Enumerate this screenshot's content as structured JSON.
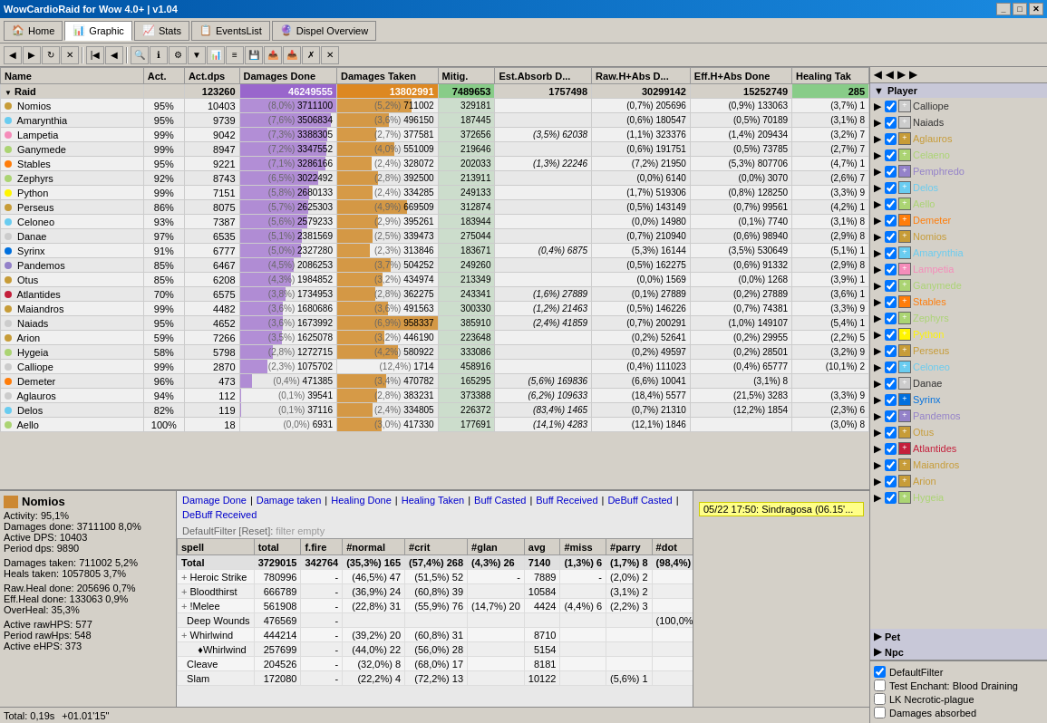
{
  "app": {
    "title": "WowCardioRaid for Wow 4.0+ | v1.04",
    "tabs": [
      "Home",
      "Graphic",
      "Stats",
      "EventsList",
      "Dispel Overview"
    ]
  },
  "toolbar_icons": [
    "arrow-left",
    "arrow-right",
    "refresh",
    "stop",
    "home",
    "search",
    "info",
    "settings",
    "filter",
    "down",
    "up",
    "save",
    "open",
    "close",
    "expand",
    "collapse",
    "chart",
    "list"
  ],
  "table": {
    "headers": [
      "Name",
      "Act.",
      "Act.dps",
      "Damages Done",
      "Damages Taken",
      "Mitig.",
      "Est.Absorb D...",
      "Raw.H+Abs D...",
      "Eff.H+Abs Done",
      "Healing Tak"
    ],
    "raid_row": {
      "name": "Raid",
      "total": "123260",
      "dmg_done": "46249555",
      "dmg_taken": "13802991",
      "mitig": "7489653",
      "absorb": "1757498",
      "raw_h": "30299142",
      "eff_h": "15252749",
      "heal_taken": "285"
    },
    "rows": [
      {
        "name": "Nomios",
        "act": "95%",
        "dps": "10403",
        "dmg_done": "3711100",
        "pct_dd": "(8,0%)",
        "dmg_taken": "711002",
        "pct_dt": "(5,2%)",
        "mitig": "329181",
        "absorb": "",
        "raw_h": "(0,7%) 205696",
        "eff_h": "(0,9%) 133063",
        "heal_taken": "(3,7%) 1",
        "class": "warrior",
        "color": "#c08020"
      },
      {
        "name": "Amarynthia",
        "act": "95%",
        "dps": "9739",
        "dmg_done": "3506834",
        "pct_dd": "(7,6%)",
        "dmg_taken": "496150",
        "pct_dt": "(3,6%)",
        "mitig": "187445",
        "absorb": "",
        "raw_h": "(0,6%) 180547",
        "eff_h": "(0,5%) 70189",
        "heal_taken": "(3,1%) 8",
        "class": "mage",
        "color": "#69ccf0"
      },
      {
        "name": "Lampetia",
        "act": "99%",
        "dps": "9042",
        "dmg_done": "3388305",
        "pct_dd": "(7,3%)",
        "dmg_taken": "377581",
        "pct_dt": "(2,7%)",
        "mitig": "372656",
        "absorb": "(3,5%) 62038",
        "raw_h": "(1,1%) 323376",
        "eff_h": "(1,4%) 209434",
        "heal_taken": "(3,2%) 7",
        "class": "paladin",
        "color": "#f58cba"
      },
      {
        "name": "Ganymede",
        "act": "99%",
        "dps": "8947",
        "dmg_done": "3347552",
        "pct_dd": "(7,2%)",
        "dmg_taken": "551009",
        "pct_dt": "(4,0%)",
        "mitig": "219646",
        "absorb": "",
        "raw_h": "(0,6%) 191751",
        "eff_h": "(0,5%) 73785",
        "heal_taken": "(2,7%) 7",
        "class": "hunter",
        "color": "#abd473"
      },
      {
        "name": "Stables",
        "act": "95%",
        "dps": "9221",
        "dmg_done": "3286166",
        "pct_dd": "(7,1%)",
        "dmg_taken": "328072",
        "pct_dt": "(2,4%)",
        "mitig": "202033",
        "absorb": "(1,3%) 22246",
        "raw_h": "(7,2%) 21950",
        "eff_h": "(5,3%) 807706",
        "heal_taken": "(4,7%) 1",
        "class": "druid",
        "color": "#ff7d0a"
      },
      {
        "name": "Zephyrs",
        "act": "92%",
        "dps": "8743",
        "dmg_done": "3022492",
        "pct_dd": "(6,5%)",
        "dmg_taken": "392500",
        "pct_dt": "(2,8%)",
        "mitig": "213911",
        "absorb": "",
        "raw_h": "(0,0%) 6140",
        "eff_h": "(0,0%) 3070",
        "heal_taken": "(2,6%) 7",
        "class": "hunter",
        "color": "#abd473"
      },
      {
        "name": "Python",
        "act": "99%",
        "dps": "7151",
        "dmg_done": "2680133",
        "pct_dd": "(5,8%)",
        "dmg_taken": "334285",
        "pct_dt": "(2,4%)",
        "mitig": "249133",
        "absorb": "",
        "raw_h": "(1,7%) 519306",
        "eff_h": "(0,8%) 128250",
        "heal_taken": "(3,3%) 9",
        "class": "rogue",
        "color": "#fff569"
      },
      {
        "name": "Perseus",
        "act": "86%",
        "dps": "8075",
        "dmg_done": "2625303",
        "pct_dd": "(5,7%)",
        "dmg_taken": "669509",
        "pct_dt": "(4,9%)",
        "mitig": "312874",
        "absorb": "",
        "raw_h": "(0,5%) 143149",
        "eff_h": "(0,7%) 99561",
        "heal_taken": "(4,2%) 1",
        "class": "warrior",
        "color": "#c79c38"
      },
      {
        "name": "Celoneo",
        "act": "93%",
        "dps": "7387",
        "dmg_done": "2579233",
        "pct_dd": "(5,6%)",
        "dmg_taken": "395261",
        "pct_dt": "(2,9%)",
        "mitig": "183944",
        "absorb": "",
        "raw_h": "(0,0%) 14980",
        "eff_h": "(0,1%) 7740",
        "heal_taken": "(3,1%) 8",
        "class": "mage",
        "color": "#69ccf0"
      },
      {
        "name": "Danae",
        "act": "97%",
        "dps": "6535",
        "dmg_done": "2381569",
        "pct_dd": "(5,1%)",
        "dmg_taken": "339473",
        "pct_dt": "(2,5%)",
        "mitig": "275044",
        "absorb": "",
        "raw_h": "(0,7%) 210940",
        "eff_h": "(0,6%) 98940",
        "heal_taken": "(2,9%) 8",
        "class": "priest",
        "color": "#ddd"
      },
      {
        "name": "Syrinx",
        "act": "91%",
        "dps": "6777",
        "dmg_done": "2327280",
        "pct_dd": "(5,0%)",
        "dmg_taken": "313846",
        "pct_dt": "(2,3%)",
        "mitig": "183671",
        "absorb": "(0,4%) 6875",
        "raw_h": "(5,3%) 16144",
        "eff_h": "(3,5%) 530649",
        "heal_taken": "(5,1%) 1",
        "class": "shaman",
        "color": "#0070de"
      },
      {
        "name": "Pandemos",
        "act": "85%",
        "dps": "6467",
        "dmg_done": "2086253",
        "pct_dd": "(4,5%)",
        "dmg_taken": "504252",
        "pct_dt": "(3,7%)",
        "mitig": "249260",
        "absorb": "",
        "raw_h": "(0,5%) 162275",
        "eff_h": "(0,6%) 91332",
        "heal_taken": "(2,9%) 8",
        "class": "warlock",
        "color": "#9482c9"
      },
      {
        "name": "Otus",
        "act": "85%",
        "dps": "6208",
        "dmg_done": "1984852",
        "pct_dd": "(4,3%)",
        "dmg_taken": "434974",
        "pct_dt": "(3,2%)",
        "mitig": "213349",
        "absorb": "",
        "raw_h": "(0,0%) 1569",
        "eff_h": "(0,0%) 1268",
        "heal_taken": "(3,9%) 1",
        "class": "warrior",
        "color": "#c79c38"
      },
      {
        "name": "Atlantides",
        "act": "70%",
        "dps": "6575",
        "dmg_done": "1734953",
        "pct_dd": "(3,8%)",
        "dmg_taken": "362275",
        "pct_dt": "(2,8%)",
        "mitig": "243341",
        "absorb": "(1,6%) 27889",
        "raw_h": "(0,1%) 27889",
        "eff_h": "(0,2%) 27889",
        "heal_taken": "(3,6%) 1",
        "class": "dk",
        "color": "#c41f3b"
      },
      {
        "name": "Maiandros",
        "act": "99%",
        "dps": "4482",
        "dmg_done": "1680686",
        "pct_dd": "(3,6%)",
        "dmg_taken": "491563",
        "pct_dt": "(3,6%)",
        "mitig": "300330",
        "absorb": "(1,2%) 21463",
        "raw_h": "(0,5%) 146226",
        "eff_h": "(0,7%) 74381",
        "heal_taken": "(3,3%) 9",
        "class": "warrior",
        "color": "#c79c38"
      },
      {
        "name": "Naiads",
        "act": "95%",
        "dps": "4652",
        "dmg_done": "1673992",
        "pct_dd": "(3,6%)",
        "dmg_taken": "958337",
        "pct_dt": "(6,9%)",
        "mitig": "385910",
        "absorb": "(2,4%) 41859",
        "raw_h": "(0,7%) 200291",
        "eff_h": "(1,0%) 149107",
        "heal_taken": "(5,4%) 1",
        "class": "priest",
        "color": "#ddd"
      },
      {
        "name": "Arion",
        "act": "59%",
        "dps": "7266",
        "dmg_done": "1625078",
        "pct_dd": "(3,5%)",
        "dmg_taken": "446190",
        "pct_dt": "(3,2%)",
        "mitig": "223648",
        "absorb": "",
        "raw_h": "(0,2%) 52641",
        "eff_h": "(0,2%) 29955",
        "heal_taken": "(2,2%) 5",
        "class": "warrior",
        "color": "#c79c38"
      },
      {
        "name": "Hygeia",
        "act": "58%",
        "dps": "5798",
        "dmg_done": "1272715",
        "pct_dd": "(2,8%)",
        "dmg_taken": "580922",
        "pct_dt": "(4,2%)",
        "mitig": "333086",
        "absorb": "",
        "raw_h": "(0,2%) 49597",
        "eff_h": "(0,2%) 28501",
        "heal_taken": "(3,2%) 9",
        "class": "hunter",
        "color": "#abd473"
      },
      {
        "name": "Calliope",
        "act": "99%",
        "dps": "2870",
        "dmg_done": "1075702",
        "pct_dd": "(2,3%)",
        "dmg_taken": "1714",
        "pct_dt": "(12,4%)",
        "mitig": "458916",
        "absorb": "",
        "raw_h": "(0,4%) 111023",
        "eff_h": "(0,4%) 65777",
        "heal_taken": "(10,1%) 2",
        "class": "priest",
        "color": "#ddd"
      },
      {
        "name": "Demeter",
        "act": "96%",
        "dps": "473",
        "dmg_done": "471385",
        "pct_dd": "(0,4%)",
        "dmg_taken": "470782",
        "pct_dt": "(3,4%)",
        "mitig": "165295",
        "absorb": "(5,6%) 169836",
        "raw_h": "(6,6%) 10041",
        "eff_h": "(3,1%) 8",
        "heal_taken": "",
        "class": "druid",
        "color": "#ff7d0a"
      },
      {
        "name": "Aglauros",
        "act": "94%",
        "dps": "112",
        "dmg_done": "39541",
        "pct_dd": "(0,1%)",
        "dmg_taken": "383231",
        "pct_dt": "(2,8%)",
        "mitig": "373388",
        "absorb": "(6,2%) 109633",
        "raw_h": "(18,4%) 5577",
        "eff_h": "(21,5%) 3283",
        "heal_taken": "(3,3%) 9",
        "class": "priest",
        "color": "#ddd"
      },
      {
        "name": "Delos",
        "act": "82%",
        "dps": "119",
        "dmg_done": "37116",
        "pct_dd": "(0,1%)",
        "dmg_taken": "334805",
        "pct_dt": "(2,4%)",
        "mitig": "226372",
        "absorb": "(83,4%) 1465",
        "raw_h": "(0,7%) 21310",
        "eff_h": "(12,2%) 1854",
        "heal_taken": "(2,3%) 6",
        "class": "mage",
        "color": "#69ccf0"
      },
      {
        "name": "Aello",
        "act": "100%",
        "dps": "18",
        "dmg_done": "6931",
        "pct_dd": "(0,0%)",
        "dmg_taken": "417330",
        "pct_dt": "(3,0%)",
        "mitig": "177691",
        "absorb": "(14,1%) 4283",
        "raw_h": "(12,1%) 1846",
        "eff_h": "",
        "heal_taken": "(3,0%) 8",
        "class": "hunter",
        "color": "#abd473"
      }
    ]
  },
  "bottom_left": {
    "player_name": "Nomios",
    "activity": "Activity: 95,1%",
    "dmg_done_val": "3711100",
    "dmg_done_pct": "8,0%",
    "active_dps": "Active DPS: 10403",
    "period_dps": "Period dps: 9890",
    "dmg_taken": "Damages taken: 711002 5,2%",
    "heals_taken": "Heals taken: 1057805 3,7%",
    "raw_heal": "Raw.Heal done: 205696 0,7%",
    "eff_heal": "Eff.Heal done: 133063 0,9%",
    "overheal": "OverHeal: 35,3%",
    "raw_hps": "Active rawHPS: 577",
    "period_hps": "Period rawHps: 548",
    "active_ehps": "Active eHPS: 373"
  },
  "detail_tabs": {
    "links": [
      "Damage Done",
      "Damage taken",
      "Healing Done",
      "Healing Taken",
      "Buff Casted",
      "Buff Received",
      "DeBuff Casted",
      "DeBuff Received"
    ],
    "filter_label": "DefaultFilter",
    "filter_reset": "[Reset]",
    "filter_text": "filter empty"
  },
  "detail_table": {
    "headers": [
      "spell",
      "total",
      "f.fire",
      "#normal",
      "#crit",
      "#glan",
      "avg",
      "#miss",
      "#parry",
      "#dot"
    ],
    "total_row": {
      "spell": "Total",
      "total": "3729015",
      "f_fire": "342764",
      "normal": "(35,3%) 165",
      "crit": "(57,4%) 268",
      "glan": "(4,3%) 26",
      "avg": "7140",
      "miss": "(1,3%) 6",
      "parry": "(1,7%) 8",
      "dot": "(98,4%)"
    },
    "rows": [
      {
        "indent": false,
        "expand": true,
        "spell": "Heroic Strike",
        "total": "780996",
        "f_fire": "-",
        "normal": "(46,5%) 47",
        "crit": "(51,5%) 52",
        "glan": "-",
        "avg": "7889",
        "miss": "-",
        "parry": "(2,0%) 2",
        "dot": ""
      },
      {
        "indent": false,
        "expand": true,
        "spell": "Bloodthirst",
        "total": "666789",
        "f_fire": "-",
        "normal": "(36,9%) 24",
        "crit": "(60,8%) 39",
        "glan": "",
        "avg": "10584",
        "miss": "",
        "parry": "(3,1%) 2",
        "dot": ""
      },
      {
        "indent": false,
        "expand": true,
        "spell": "!Melee",
        "total": "561908",
        "f_fire": "-",
        "normal": "(22,8%) 31",
        "crit": "(55,9%) 76",
        "glan": "(14,7%) 20",
        "avg": "4424",
        "miss": "(4,4%) 6",
        "parry": "(2,2%) 3",
        "dot": ""
      },
      {
        "indent": false,
        "expand": false,
        "spell": "Deep Wounds",
        "total": "476569",
        "f_fire": "-",
        "normal": "",
        "crit": "",
        "glan": "",
        "avg": "",
        "miss": "",
        "parry": "",
        "dot": "(100,0%)"
      },
      {
        "indent": false,
        "expand": true,
        "spell": "Whirlwind",
        "total": "444214",
        "f_fire": "-",
        "normal": "(39,2%) 20",
        "crit": "(60,8%) 31",
        "glan": "",
        "avg": "8710",
        "miss": "",
        "parry": "",
        "dot": ""
      },
      {
        "indent": true,
        "expand": false,
        "spell": "♦Whirlwind",
        "total": "257699",
        "f_fire": "-",
        "normal": "(44,0%) 22",
        "crit": "(56,0%) 28",
        "glan": "",
        "avg": "5154",
        "miss": "",
        "parry": "",
        "dot": ""
      },
      {
        "indent": false,
        "expand": false,
        "spell": "Cleave",
        "total": "204526",
        "f_fire": "-",
        "normal": "(32,0%) 8",
        "crit": "(68,0%) 17",
        "glan": "",
        "avg": "8181",
        "miss": "",
        "parry": "",
        "dot": ""
      },
      {
        "indent": false,
        "expand": false,
        "spell": "Slam",
        "total": "172080",
        "f_fire": "-",
        "normal": "(22,2%) 4",
        "crit": "(72,2%) 13",
        "glan": "",
        "avg": "10122",
        "miss": "",
        "parry": "(5,6%) 1",
        "dot": ""
      }
    ]
  },
  "right_panel": {
    "sections": [
      "Player",
      "Pet",
      "Npc"
    ],
    "players": [
      {
        "name": "Calliope",
        "class": "priest",
        "checked": true
      },
      {
        "name": "Naiads",
        "class": "priest",
        "checked": true
      },
      {
        "name": "Aglauros",
        "class": "warrior",
        "checked": true
      },
      {
        "name": "Celaeno",
        "class": "hunter",
        "checked": true
      },
      {
        "name": "Pemphredo",
        "class": "warlock",
        "checked": true
      },
      {
        "name": "Delos",
        "class": "mage",
        "checked": true
      },
      {
        "name": "Aello",
        "class": "hunter",
        "checked": true
      },
      {
        "name": "Demeter",
        "class": "druid",
        "checked": true
      },
      {
        "name": "Nomios",
        "class": "warrior",
        "checked": true
      },
      {
        "name": "Amarynthia",
        "class": "mage",
        "checked": true
      },
      {
        "name": "Lampetia",
        "class": "paladin",
        "checked": true
      },
      {
        "name": "Ganymede",
        "class": "hunter",
        "checked": true
      },
      {
        "name": "Stables",
        "class": "druid",
        "checked": true
      },
      {
        "name": "Zephyrs",
        "class": "hunter",
        "checked": true
      },
      {
        "name": "Python",
        "class": "rogue",
        "checked": true
      },
      {
        "name": "Perseus",
        "class": "warrior",
        "checked": true
      },
      {
        "name": "Celoneo",
        "class": "mage",
        "checked": true
      },
      {
        "name": "Danae",
        "class": "priest",
        "checked": true
      },
      {
        "name": "Syrinx",
        "class": "shaman",
        "checked": true
      },
      {
        "name": "Pandemos",
        "class": "warlock",
        "checked": true
      },
      {
        "name": "Otus",
        "class": "warrior",
        "checked": true
      },
      {
        "name": "Atlantides",
        "class": "dk",
        "checked": true
      },
      {
        "name": "Maiandros",
        "class": "warrior",
        "checked": true
      },
      {
        "name": "Arion",
        "class": "warrior",
        "checked": true
      },
      {
        "name": "Hygeia",
        "class": "hunter",
        "checked": true
      }
    ]
  },
  "bottom_right_filters": {
    "items": [
      {
        "label": "DefaultFilter",
        "checked": true
      },
      {
        "label": "Test Enchant: Blood Draining",
        "checked": false
      },
      {
        "label": "LK Necrotic-plague",
        "checked": false
      },
      {
        "label": "Damages absorbed",
        "checked": false
      }
    ],
    "log_entry": "05/22 17:50: Sindragosa (06.15'..."
  },
  "status_bar": {
    "total": "Total: 0,19s",
    "time": "+01.01'15\""
  }
}
